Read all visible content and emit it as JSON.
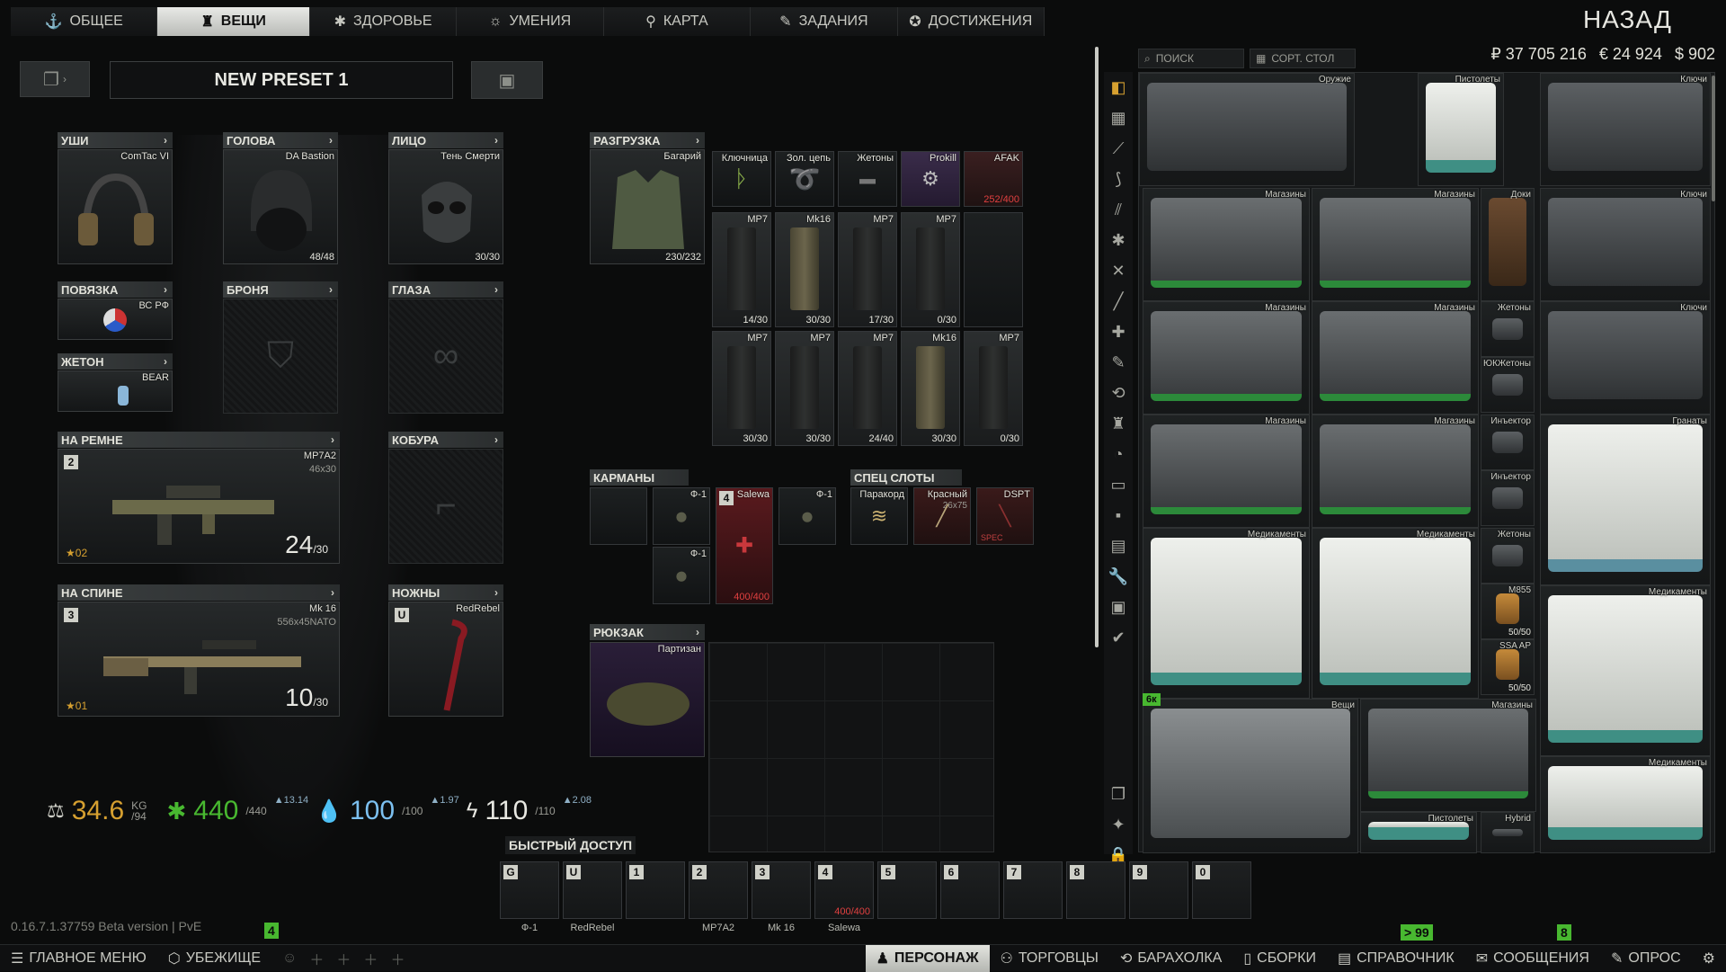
{
  "tabs": [
    {
      "label": "ОБЩЕЕ",
      "icon": "figure-icon"
    },
    {
      "label": "ВЕЩИ",
      "icon": "gear-figure-icon"
    },
    {
      "label": "ЗДОРОВЬЕ",
      "icon": "health-icon"
    },
    {
      "label": "УМЕНИЯ",
      "icon": "skills-icon"
    },
    {
      "label": "КАРТА",
      "icon": "map-pin-icon"
    },
    {
      "label": "ЗАДАНИЯ",
      "icon": "tasks-icon"
    },
    {
      "label": "ДОСТИЖЕНИЯ",
      "icon": "achievement-icon"
    }
  ],
  "back_label": "НАЗАД",
  "preset": {
    "name": "NEW PRESET 1"
  },
  "slots": {
    "ears": {
      "label": "УШИ",
      "item": "ComTac VI"
    },
    "head": {
      "label": "ГОЛОВА",
      "item": "DA Bastion",
      "count": "48/48"
    },
    "face": {
      "label": "ЛИЦО",
      "item": "Тень Смерти",
      "count": "30/30"
    },
    "armband": {
      "label": "ПОВЯЗКА",
      "item": "ВС РФ"
    },
    "armor": {
      "label": "БРОНЯ"
    },
    "eyes": {
      "label": "ГЛАЗА"
    },
    "dogtag": {
      "label": "ЖЕТОН",
      "item": "BEAR"
    },
    "sling": {
      "label": "НА РЕМНЕ",
      "item": "MP7A2",
      "caliber": "46x30",
      "key": "2",
      "ammo": "24",
      "ammo_max": "/30",
      "level": "02"
    },
    "holster": {
      "label": "КОБУРА"
    },
    "back": {
      "label": "НА СПИНЕ",
      "item": "Mk 16",
      "caliber": "556x45NATO",
      "key": "3",
      "ammo": "10",
      "ammo_max": "/30",
      "level": "01"
    },
    "melee": {
      "label": "НОЖНЫ",
      "item": "RedRebel",
      "key": "U"
    },
    "rig": {
      "label": "РАЗГРУЗКА",
      "item": "Багарий",
      "count": "230/232"
    },
    "pockets": {
      "label": "КАРМАНЫ"
    },
    "special": {
      "label": "СПЕЦ СЛОТЫ"
    },
    "backpack": {
      "label": "РЮКЗАК",
      "item": "Партизан"
    }
  },
  "rig_items": [
    {
      "name": "Ключница",
      "count": ""
    },
    {
      "name": "Зол. цепь",
      "count": ""
    },
    {
      "name": "Жетоны",
      "count": ""
    },
    {
      "name": "Prokill",
      "count": ""
    },
    {
      "name": "AFAK",
      "count": "252/400"
    },
    {
      "name": "MP7",
      "count": "14/30"
    },
    {
      "name": "Mk16",
      "count": "30/30"
    },
    {
      "name": "MP7",
      "count": "17/30"
    },
    {
      "name": "MP7",
      "count": "0/30"
    },
    {
      "name": "MP7",
      "count": "30/30"
    },
    {
      "name": "MP7",
      "count": "30/30"
    },
    {
      "name": "MP7",
      "count": "24/40"
    },
    {
      "name": "Mk16",
      "count": "30/30"
    },
    {
      "name": "MP7",
      "count": "0/30"
    }
  ],
  "pocket_items": [
    {
      "name": "Ф-1"
    },
    {
      "name": "Ф-1"
    },
    {
      "name": "Salewa",
      "key": "4",
      "count": "400/400"
    },
    {
      "name": "Ф-1"
    }
  ],
  "special_items": [
    {
      "name": "Паракорд"
    },
    {
      "name": "Красный",
      "sub": "26x75"
    },
    {
      "name": "DSPT",
      "sub": "SPEC"
    }
  ],
  "stats": {
    "weight": "34.6",
    "weight_unit": "KG",
    "weight_max": "/94",
    "health": "440",
    "health_max": "/440",
    "health_up": "13.14",
    "hydration": "100",
    "hydration_max": "/100",
    "hydration_up": "1.97",
    "energy": "110",
    "energy_max": "/110",
    "energy_up": "2.08"
  },
  "quick_access": {
    "label": "БЫСТРЫЙ ДОСТУП",
    "slots": [
      {
        "key": "G",
        "name": "Ф-1"
      },
      {
        "key": "U",
        "name": "RedRebel"
      },
      {
        "key": "1",
        "name": ""
      },
      {
        "key": "2",
        "name": "MP7A2"
      },
      {
        "key": "3",
        "name": "Mk 16"
      },
      {
        "key": "4",
        "name": "Salewa",
        "count": "400/400"
      },
      {
        "key": "5",
        "name": ""
      },
      {
        "key": "6",
        "name": ""
      },
      {
        "key": "7",
        "name": ""
      },
      {
        "key": "8",
        "name": ""
      },
      {
        "key": "9",
        "name": ""
      },
      {
        "key": "0",
        "name": ""
      }
    ]
  },
  "stash": {
    "search_placeholder": "ПОИСК",
    "sort_label": "СОРТ. СТОЛ",
    "currency": {
      "rub": "₽ 37 705 216",
      "eur": "€ 24 924",
      "usd": "$ 902"
    },
    "cases": [
      {
        "name": "Оружие",
        "type": "rifle"
      },
      {
        "name": "Пистолеты",
        "type": "white"
      },
      {
        "name": "Ключи",
        "type": "key"
      },
      {
        "name": "Магазины",
        "type": "green"
      },
      {
        "name": "Магазины",
        "type": "green"
      },
      {
        "name": "Доки",
        "type": "docs"
      },
      {
        "name": "Ключи",
        "type": "key"
      },
      {
        "name": "Магазины",
        "type": "green"
      },
      {
        "name": "Магазины",
        "type": "green"
      },
      {
        "name": "Жетоны",
        "type": "small"
      },
      {
        "name": "ЮКЖетоны",
        "type": "small"
      },
      {
        "name": "Ключи",
        "type": "key"
      },
      {
        "name": "Магазины",
        "type": "green"
      },
      {
        "name": "Магазины",
        "type": "green"
      },
      {
        "name": "Инъектор",
        "type": "small"
      },
      {
        "name": "Инъектор",
        "type": "small"
      },
      {
        "name": "Гранаты",
        "type": "grenade"
      },
      {
        "name": "Медикаменты",
        "type": "white"
      },
      {
        "name": "Медикаменты",
        "type": "white"
      },
      {
        "name": "Жетоны",
        "type": "small"
      },
      {
        "name": "M855",
        "type": "ammo",
        "count": "50/50"
      },
      {
        "name": "SSA AP",
        "type": "ammo",
        "count": "50/50"
      },
      {
        "name": "Медикаменты",
        "type": "white"
      },
      {
        "name": "Вещи",
        "type": "big"
      },
      {
        "name": "Магазины",
        "type": "green"
      },
      {
        "name": "Медикаменты",
        "type": "white"
      },
      {
        "name": "Пистолеты",
        "type": "white"
      },
      {
        "name": "Hybrid",
        "type": "small"
      }
    ],
    "tag": "6к"
  },
  "version": "0.16.7.1.37759 Beta version | PvE",
  "badges": {
    "version": "4",
    "left": "> 99",
    "right": "8"
  },
  "bottom_nav": [
    {
      "label": "ГЛАВНОЕ МЕНЮ",
      "icon": "menu-icon"
    },
    {
      "label": "УБЕЖИЩЕ",
      "icon": "hideout-icon"
    },
    {
      "label": "ПЕРСОНАЖ",
      "icon": "character-icon"
    },
    {
      "label": "ТОРГОВЦЫ",
      "icon": "traders-icon"
    },
    {
      "label": "БАРАХОЛКА",
      "icon": "flea-icon"
    },
    {
      "label": "СБОРКИ",
      "icon": "builds-icon"
    },
    {
      "label": "СПРАВОЧНИК",
      "icon": "handbook-icon"
    },
    {
      "label": "СООБЩЕНИЯ",
      "icon": "messages-icon"
    },
    {
      "label": "ОПРОС",
      "icon": "survey-icon"
    }
  ],
  "colors": {
    "accent_green": "#48b830",
    "red": "#e04040",
    "gold": "#d6a030"
  }
}
